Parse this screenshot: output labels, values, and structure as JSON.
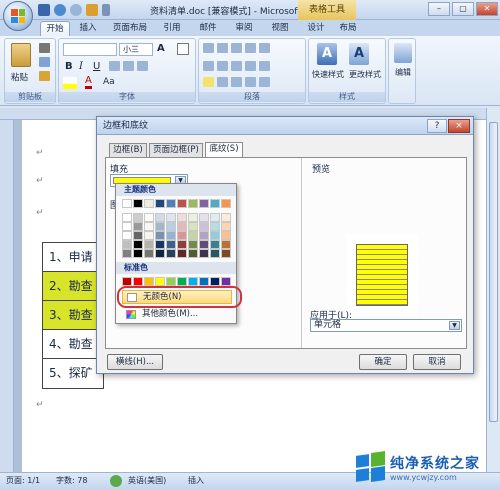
{
  "window": {
    "title": "资料清单.doc [兼容模式] - Microsoft ...",
    "contextual_tab": "表格工具"
  },
  "ribbon_tabs": [
    "开始",
    "插入",
    "页面布局",
    "引用",
    "邮件",
    "审阅",
    "视图",
    "设计",
    "布局"
  ],
  "ribbon": {
    "clipboard": {
      "paste_label": "粘贴",
      "group_label": "剪贴板"
    },
    "font": {
      "size_value": "小三",
      "group_label": "字体",
      "bold": "B",
      "italic": "I",
      "underline": "U",
      "grow_font": "A",
      "text_color": "A",
      "format": "Aa"
    },
    "paragraph": {
      "group_label": "段落"
    },
    "styles": {
      "quick_styles": "快速样式",
      "change_styles": "更改样式",
      "group_label": "样式"
    },
    "editing": {
      "label": "编辑"
    }
  },
  "document": {
    "rows": [
      "1、申请",
      "2、勘查",
      "3、勘查",
      "4、勘查",
      "5、探矿"
    ],
    "highlighted_rows": [
      1,
      2
    ],
    "para_mark": "↵"
  },
  "dialog": {
    "title": "边框和底纹",
    "help": "?",
    "close": "×",
    "tabs": [
      "边框(B)",
      "页面边框(P)",
      "底纹(S)"
    ],
    "active_tab": 2,
    "fill_label": "填充",
    "pattern_label": "图",
    "fill_color": "#ffff00",
    "preview_label": "预览",
    "apply_to_label": "应用于(L):",
    "apply_to_value": "单元格",
    "horizontal_line_button": "横线(H)...",
    "ok_button": "确定",
    "cancel_button": "取消"
  },
  "color_palette": {
    "theme_header": "主题颜色",
    "standard_header": "标准色",
    "no_color": "无颜色(N)",
    "more_colors": "其他颜色(M)...",
    "theme_colors": [
      "#ffffff",
      "#000000",
      "#eeece1",
      "#1f497d",
      "#4f81bd",
      "#c0504d",
      "#9bbb59",
      "#8064a2",
      "#4bacc6",
      "#f79646"
    ],
    "standard_colors": [
      "#c00000",
      "#ff0000",
      "#ffc000",
      "#ffff00",
      "#92d050",
      "#00b050",
      "#00b0f0",
      "#0070c0",
      "#002060",
      "#7030a0"
    ]
  },
  "status_bar": {
    "page": "页面: 1/1",
    "words": "字数: 78",
    "language": "英语(美国)",
    "mode": "插入"
  },
  "watermark": {
    "text": "纯净系统之家",
    "url": "www.ycwjzy.com"
  }
}
